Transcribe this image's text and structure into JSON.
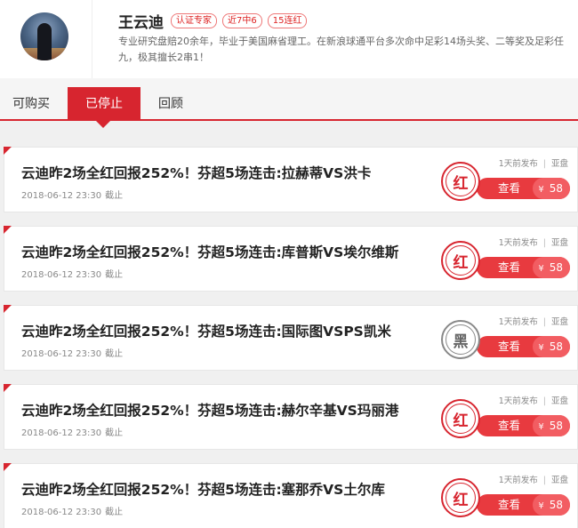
{
  "profile": {
    "name": "王云迪",
    "tags": [
      "认证专家",
      "近7中6",
      "15连红"
    ],
    "bio": "专业研究盘赔20余年，毕业于美国麻省理工。在新浪球通平台多次命中足彩14场头奖、二等奖及足彩任九，极其擅长2串1！"
  },
  "tabs": [
    "可购买",
    "已停止",
    "回顾"
  ],
  "active_tab": "已停止",
  "cards": [
    {
      "title": "云迪昨2场全红回报252%！芬超5场连击:拉赫蒂VS洪卡",
      "date": "2018-06-12 23:30",
      "status": "截止",
      "published": "1天前发布",
      "type": "亚盘",
      "stamp": "红",
      "view": "查看",
      "currency": "¥",
      "price": "58"
    },
    {
      "title": "云迪昨2场全红回报252%！芬超5场连击:库普斯VS埃尔维斯",
      "date": "2018-06-12 23:30",
      "status": "截止",
      "published": "1天前发布",
      "type": "亚盘",
      "stamp": "红",
      "view": "查看",
      "currency": "¥",
      "price": "58"
    },
    {
      "title": "云迪昨2场全红回报252%！芬超5场连击:国际图VSPS凯米",
      "date": "2018-06-12 23:30",
      "status": "截止",
      "published": "1天前发布",
      "type": "亚盘",
      "stamp": "黑",
      "view": "查看",
      "currency": "¥",
      "price": "58"
    },
    {
      "title": "云迪昨2场全红回报252%！芬超5场连击:赫尔辛基VS玛丽港",
      "date": "2018-06-12 23:30",
      "status": "截止",
      "published": "1天前发布",
      "type": "亚盘",
      "stamp": "红",
      "view": "查看",
      "currency": "¥",
      "price": "58"
    },
    {
      "title": "云迪昨2场全红回报252%！芬超5场连击:塞那乔VS土尔库",
      "date": "2018-06-12 23:30",
      "status": "截止",
      "published": "1天前发布",
      "type": "亚盘",
      "stamp": "红",
      "view": "查看",
      "currency": "¥",
      "price": "58"
    }
  ]
}
